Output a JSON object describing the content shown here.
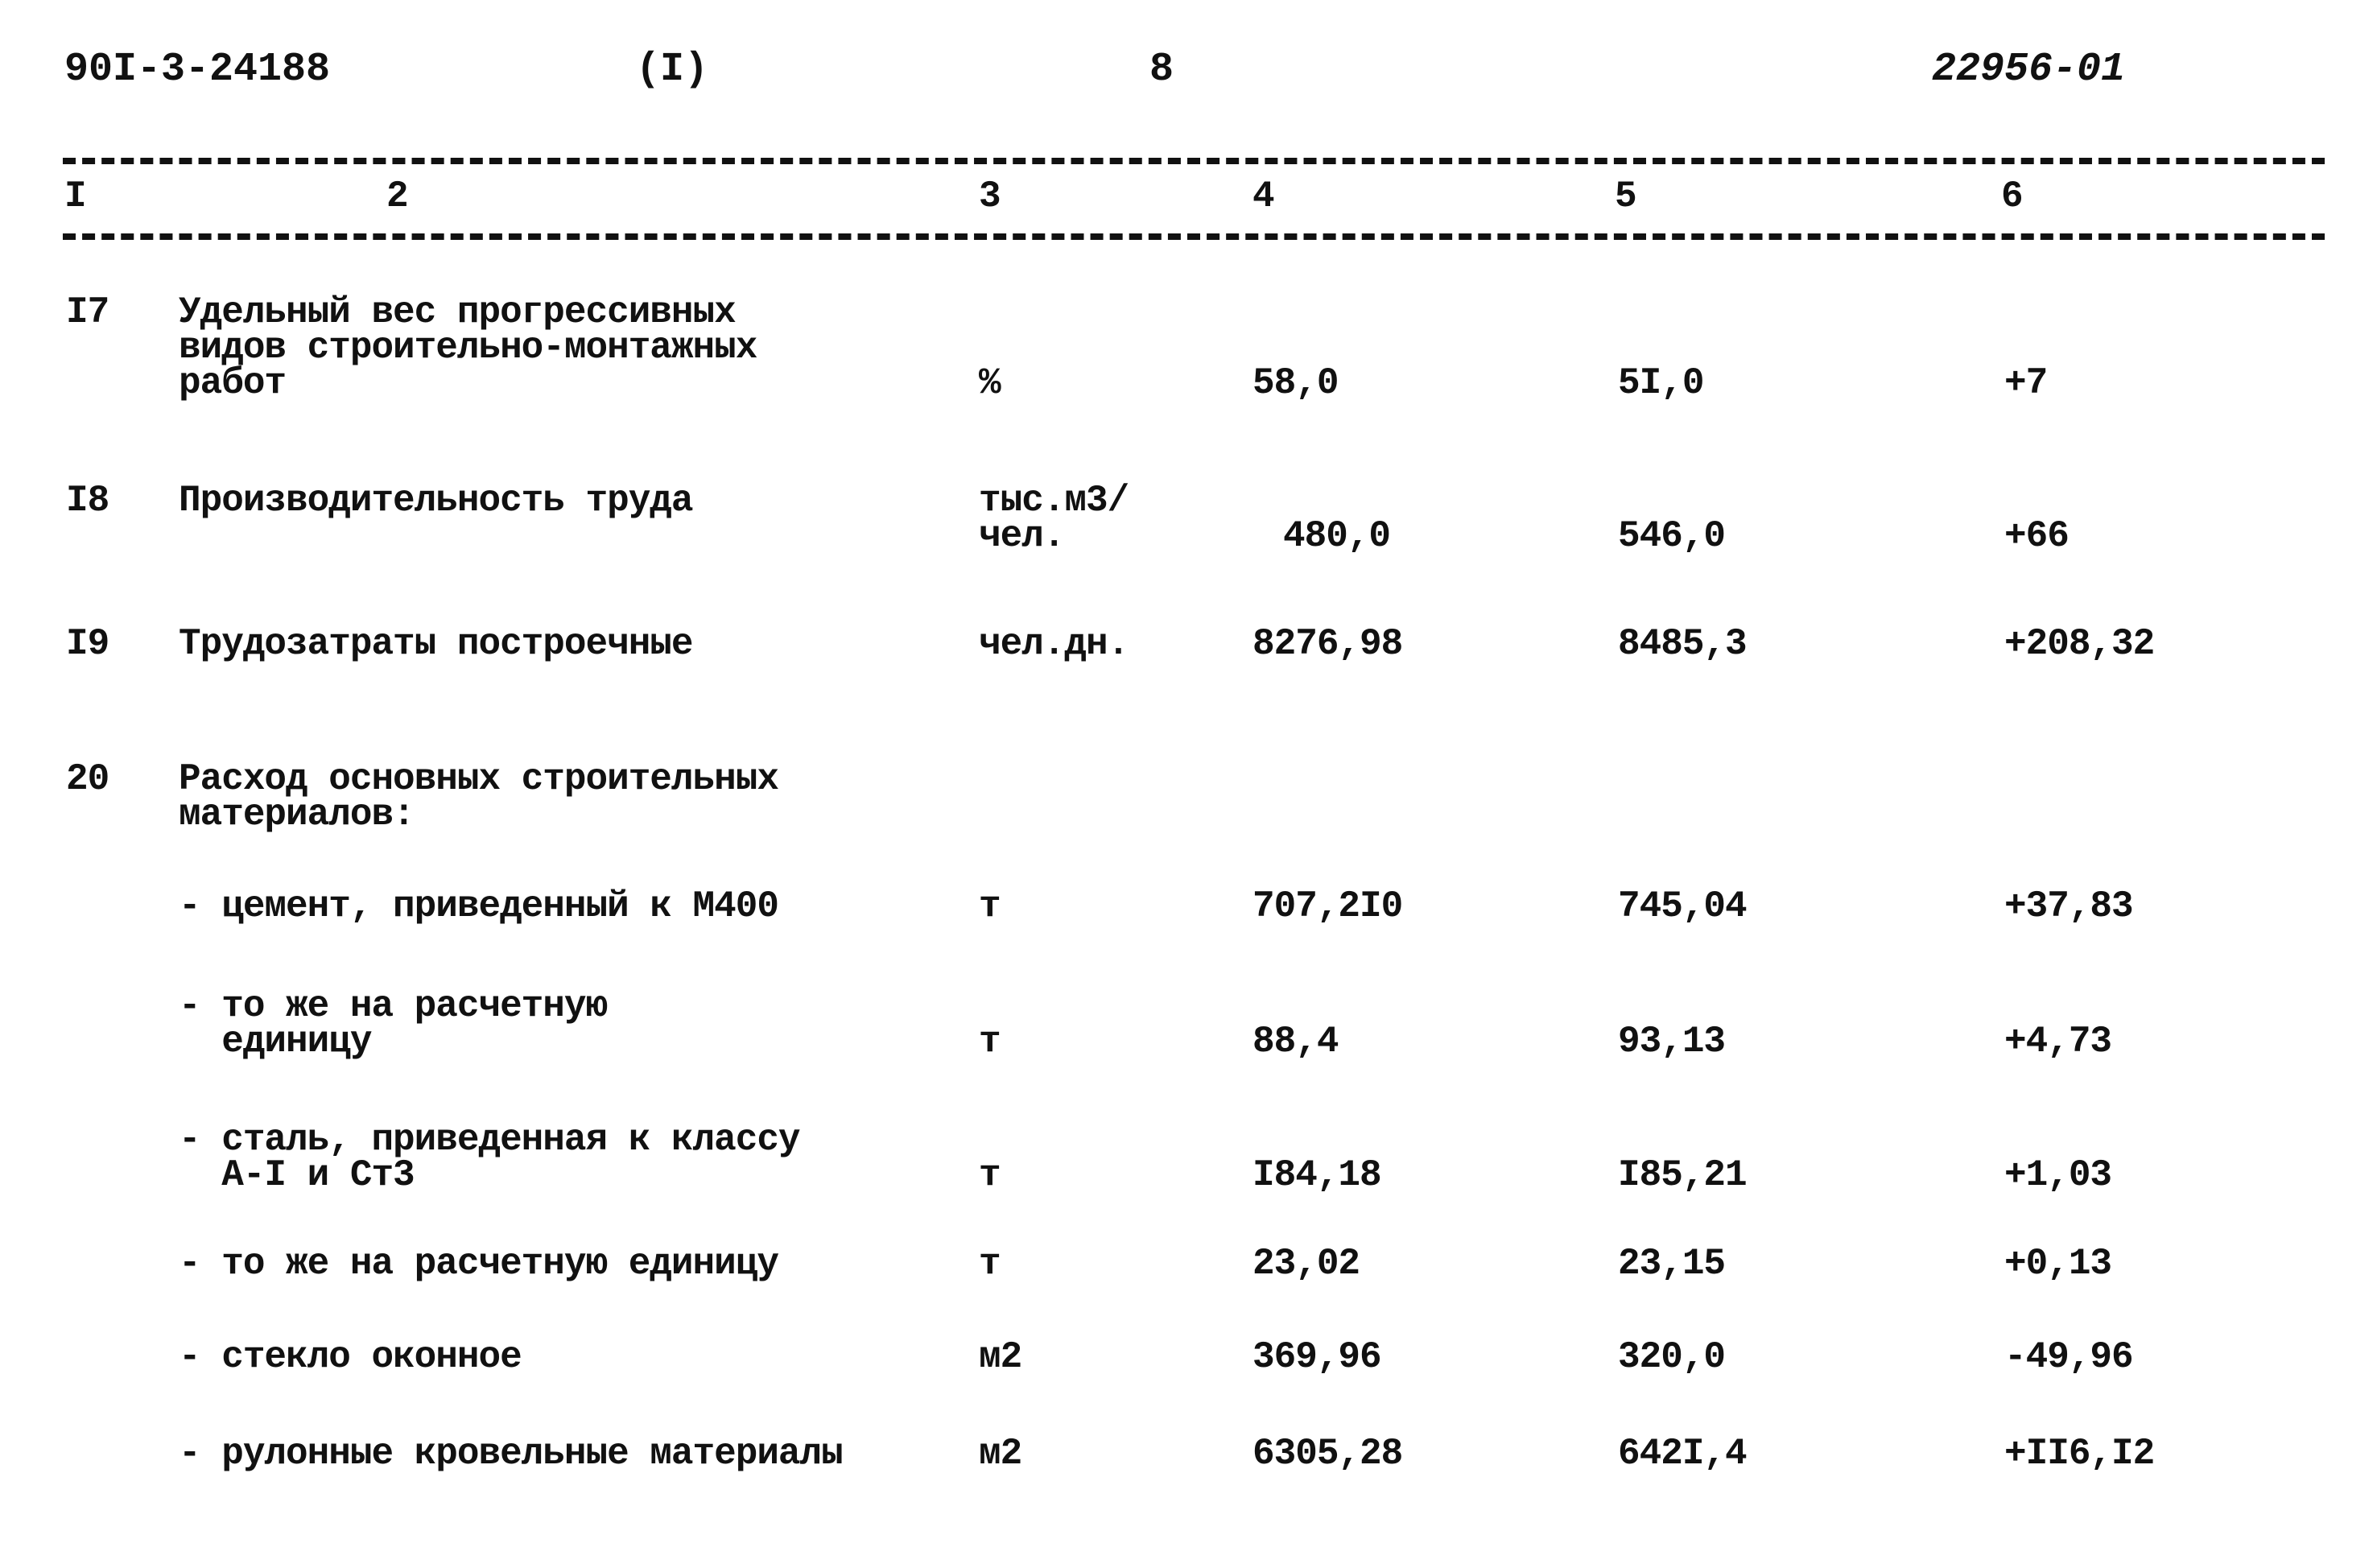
{
  "header": {
    "doc_code": "90I-3-24188",
    "part": "(I)",
    "page": "8",
    "reg_number": "22956-01"
  },
  "columns": [
    "I",
    "2",
    "3",
    "4",
    "5",
    "6"
  ],
  "rows": [
    {
      "num": "I7",
      "name": [
        "Удельный вес прогрессивных",
        "видов строительно-монтажных",
        "работ"
      ],
      "unit": [
        "%"
      ],
      "c4": "58,0",
      "c5": "5I,0",
      "c6": "+7"
    },
    {
      "num": "I8",
      "name": [
        "Производительность труда"
      ],
      "unit": [
        "тыс.м3/",
        "чел."
      ],
      "c4": "480,0",
      "c5": "546,0",
      "c6": "+66"
    },
    {
      "num": "I9",
      "name": [
        "Трудозатраты построечные"
      ],
      "unit": [
        "чел.дн."
      ],
      "c4": "8276,98",
      "c5": "8485,3",
      "c6": "+208,32"
    },
    {
      "num": "20",
      "name": [
        "Расход основных строительных",
        "материалов:"
      ],
      "unit": [],
      "c4": "",
      "c5": "",
      "c6": ""
    },
    {
      "num": "",
      "name": [
        "- цемент, приведенный к М400"
      ],
      "unit": [
        "т"
      ],
      "c4": "707,2I0",
      "c5": "745,04",
      "c6": "+37,83"
    },
    {
      "num": "",
      "name": [
        "- то же на расчетную",
        "  единицу"
      ],
      "unit": [
        "т"
      ],
      "c4": "88,4",
      "c5": "93,13",
      "c6": "+4,73"
    },
    {
      "num": "",
      "name": [
        "- сталь, приведенная к классу",
        "  А-I и Ст3"
      ],
      "unit": [
        "т"
      ],
      "c4": "I84,18",
      "c5": "I85,21",
      "c6": "+1,03"
    },
    {
      "num": "",
      "name": [
        "- то же на расчетную единицу"
      ],
      "unit": [
        "т"
      ],
      "c4": "23,02",
      "c5": "23,15",
      "c6": "+0,13"
    },
    {
      "num": "",
      "name": [
        "- стекло оконное"
      ],
      "unit": [
        "м2"
      ],
      "c4": "369,96",
      "c5": "320,0",
      "c6": "-49,96"
    },
    {
      "num": "",
      "name": [
        "- рулонные кровельные материалы"
      ],
      "unit": [
        "м2"
      ],
      "c4": "6305,28",
      "c5": "642I,4",
      "c6": "+II6,I2"
    }
  ]
}
